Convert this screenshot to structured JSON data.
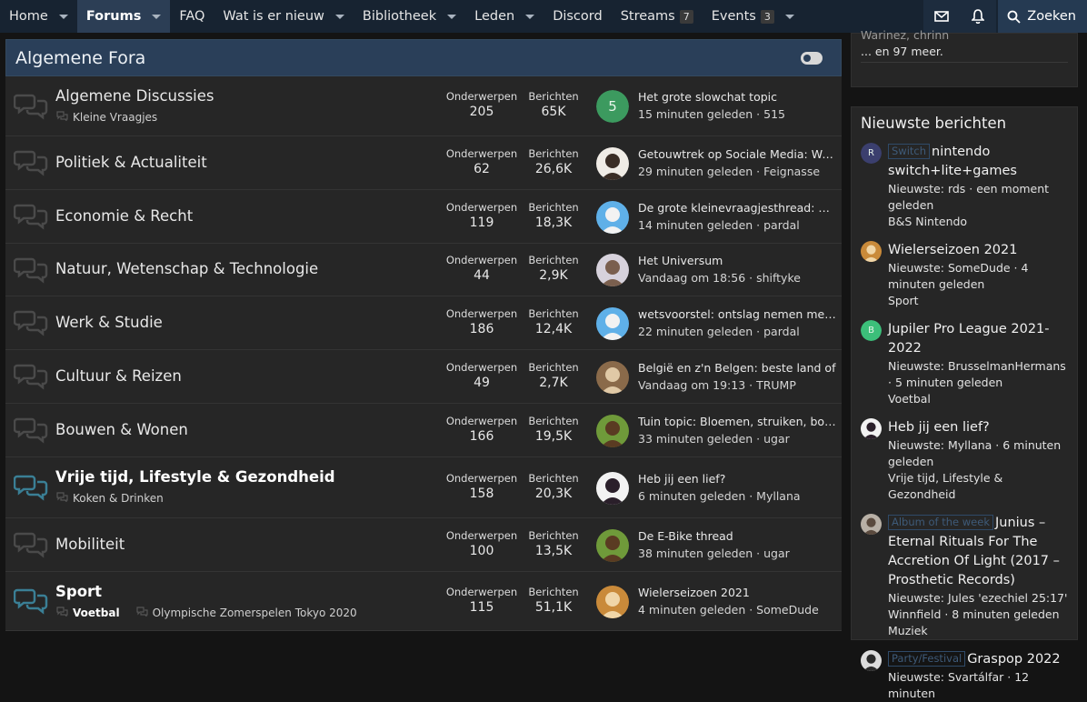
{
  "nav": {
    "items": [
      {
        "label": "Home",
        "caret": true,
        "active": false
      },
      {
        "label": "Forums",
        "caret": true,
        "active": true
      },
      {
        "label": "FAQ",
        "caret": false,
        "active": false
      },
      {
        "label": "Wat is er nieuw",
        "caret": true,
        "active": false
      },
      {
        "label": "Bibliotheek",
        "caret": true,
        "active": false
      },
      {
        "label": "Leden",
        "caret": true,
        "active": false
      },
      {
        "label": "Discord",
        "caret": false,
        "active": false
      },
      {
        "label": "Streams",
        "count": "7",
        "caret": false,
        "active": false
      },
      {
        "label": "Events",
        "count": "3",
        "caret": true,
        "active": false
      }
    ],
    "search_label": "Zoeken",
    "icons": [
      "envelope-icon",
      "bell-icon",
      "search-icon"
    ]
  },
  "category": {
    "title": "Algemene Fora"
  },
  "labels": {
    "topics": "Onderwerpen",
    "posts": "Berichten"
  },
  "forums": [
    {
      "name": "Algemene Discussies",
      "bold": false,
      "unread": false,
      "subs": [
        {
          "name": "Kleine Vraagjes",
          "bold": false
        }
      ],
      "topics": "205",
      "posts": "65K",
      "last_title": "Het grote slowchat topic",
      "last_meta": "15 minuten geleden · 515",
      "avatar": {
        "type": "letter",
        "letter": "5",
        "color": "#3c9a5f"
      }
    },
    {
      "name": "Politiek & Actualiteit",
      "bold": false,
      "unread": false,
      "subs": [],
      "topics": "62",
      "posts": "26,6K",
      "last_title": "Getouwtrek op Sociale Media: Woke vs Anti-Woke",
      "last_meta": "29 minuten geleden · Feignasse",
      "avatar": {
        "type": "pic",
        "bg": "#f0ece6",
        "fg": "#3a2d25"
      }
    },
    {
      "name": "Economie & Recht",
      "bold": false,
      "unread": false,
      "subs": [],
      "topics": "119",
      "posts": "18,3K",
      "last_title": "De grote kleinevraagjesthread: economie",
      "last_meta": "14 minuten geleden · pardal",
      "avatar": {
        "type": "pic",
        "bg": "#5fb0e8",
        "fg": "#f2f2f2"
      }
    },
    {
      "name": "Natuur, Wetenschap & Technologie",
      "bold": false,
      "unread": false,
      "subs": [],
      "topics": "44",
      "posts": "2,9K",
      "last_title": "Het Universum",
      "last_meta": "Vandaag om 18:56 · shiftyke",
      "avatar": {
        "type": "pic",
        "bg": "#d7d2dc",
        "fg": "#7a5f4e"
      }
    },
    {
      "name": "Werk & Studie",
      "bold": false,
      "unread": false,
      "subs": [],
      "topics": "186",
      "posts": "12,4K",
      "last_title": "wetsvoorstel: ontslag nemen met behoud",
      "last_meta": "22 minuten geleden · pardal",
      "avatar": {
        "type": "pic",
        "bg": "#5fb0e8",
        "fg": "#f2f2f2"
      }
    },
    {
      "name": "Cultuur & Reizen",
      "bold": false,
      "unread": false,
      "subs": [],
      "topics": "49",
      "posts": "2,7K",
      "last_title": "België en z'n Belgen: beste land of",
      "last_meta": "Vandaag om 19:13 · TRUMP",
      "avatar": {
        "type": "pic",
        "bg": "#8a6a4a",
        "fg": "#e0c9a6"
      }
    },
    {
      "name": "Bouwen & Wonen",
      "bold": false,
      "unread": false,
      "subs": [],
      "topics": "166",
      "posts": "19,5K",
      "last_title": "Tuin topic: Bloemen, struiken, bomen",
      "last_meta": "33 minuten geleden · ugar",
      "avatar": {
        "type": "pic",
        "bg": "#6f9a3a",
        "fg": "#5a3b22"
      }
    },
    {
      "name": "Vrije tijd, Lifestyle & Gezondheid",
      "bold": true,
      "unread": true,
      "subs": [
        {
          "name": "Koken & Drinken",
          "bold": false
        }
      ],
      "topics": "158",
      "posts": "20,3K",
      "last_title": "Heb jij een lief?",
      "last_meta": "6 minuten geleden · Myllana",
      "avatar": {
        "type": "pic",
        "bg": "#f2f2f2",
        "fg": "#2a1f2a"
      }
    },
    {
      "name": "Mobiliteit",
      "bold": false,
      "unread": false,
      "subs": [],
      "topics": "100",
      "posts": "13,5K",
      "last_title": "De E-Bike thread",
      "last_meta": "38 minuten geleden · ugar",
      "avatar": {
        "type": "pic",
        "bg": "#6f9a3a",
        "fg": "#5a3b22"
      }
    },
    {
      "name": "Sport",
      "bold": true,
      "unread": true,
      "subs": [
        {
          "name": "Voetbal",
          "bold": true
        },
        {
          "name": "Olympische Zomerspelen Tokyo 2020",
          "bold": false
        }
      ],
      "topics": "115",
      "posts": "51,1K",
      "last_title": "Wielerseizoen 2021",
      "last_meta": "4 minuten geleden · SomeDude",
      "avatar": {
        "type": "pic",
        "bg": "#c98a3a",
        "fg": "#f0d6a8"
      }
    }
  ],
  "sidebar_top": {
    "faded": "Warinez, chrinn",
    "more": "... en 97 meer."
  },
  "newest": {
    "title": "Nieuwste berichten",
    "posts": [
      {
        "prefix": "Switch",
        "title": "nintendo switch+lite+games",
        "meta": "Nieuwste: rds · een moment geleden",
        "forum": "B&S Nintendo",
        "avatar": {
          "type": "letter",
          "letter": "R",
          "color": "#3b3f6e"
        }
      },
      {
        "prefix": "",
        "title": "Wielerseizoen 2021",
        "meta": "Nieuwste: SomeDude · 4 minuten geleden",
        "forum": "Sport",
        "avatar": {
          "type": "pic",
          "bg": "#c98a3a",
          "fg": "#f0d6a8"
        }
      },
      {
        "prefix": "",
        "title": "Jupiler Pro League 2021-2022",
        "meta": "Nieuwste: BrusselmanHermans · 5 minuten geleden",
        "forum": "Voetbal",
        "avatar": {
          "type": "letter",
          "letter": "B",
          "color": "#3cbf7a"
        }
      },
      {
        "prefix": "",
        "title": "Heb jij een lief?",
        "meta": "Nieuwste: Myllana · 6 minuten geleden",
        "forum": "Vrije tijd, Lifestyle & Gezondheid",
        "avatar": {
          "type": "pic",
          "bg": "#f2f2f2",
          "fg": "#2a1f2a"
        }
      },
      {
        "prefix": "Album of the week",
        "title": "Junius – Eternal Rituals For The Accretion Of Light (2017 – Prosthetic Records)",
        "meta": "Nieuwste: Jules 'ezechiel 25:17' Winnfield · 8 minuten geleden",
        "forum": "Muziek",
        "avatar": {
          "type": "pic",
          "bg": "#b8b0a6",
          "fg": "#5a4a3e"
        }
      },
      {
        "prefix": "Party/Festival",
        "title": "Graspop 2022",
        "meta": "Nieuwste: Svartálfar · 12 minuten",
        "forum": "",
        "avatar": {
          "type": "pic",
          "bg": "#dcdcdc",
          "fg": "#2a2a2a"
        }
      }
    ]
  }
}
